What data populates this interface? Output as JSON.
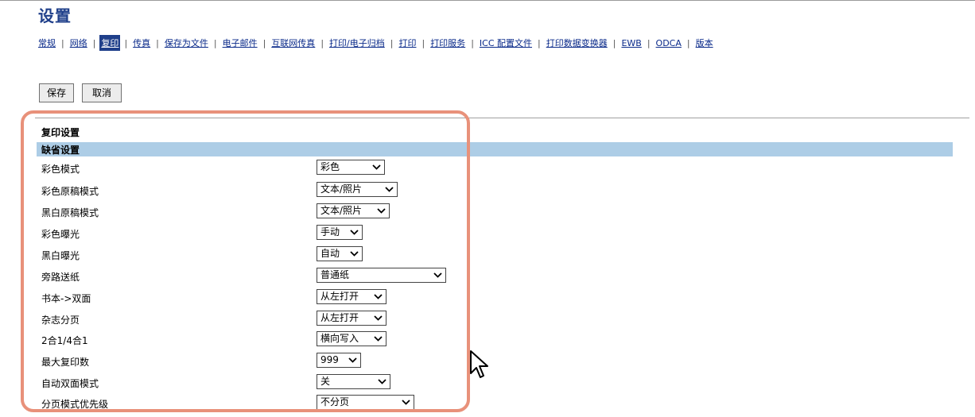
{
  "page": {
    "title": "设置"
  },
  "tabs": [
    {
      "label": "常规",
      "active": false
    },
    {
      "label": "网络",
      "active": false
    },
    {
      "label": "复印",
      "active": true
    },
    {
      "label": "传真",
      "active": false
    },
    {
      "label": "保存为文件",
      "active": false
    },
    {
      "label": "电子邮件",
      "active": false
    },
    {
      "label": "互联网传真",
      "active": false
    },
    {
      "label": "打印/电子归档",
      "active": false
    },
    {
      "label": "打印",
      "active": false
    },
    {
      "label": "打印服务",
      "active": false
    },
    {
      "label": "ICC 配置文件",
      "active": false
    },
    {
      "label": "打印数据变换器",
      "active": false
    },
    {
      "label": "EWB",
      "active": false
    },
    {
      "label": "ODCA",
      "active": false
    },
    {
      "label": "版本",
      "active": false
    }
  ],
  "toolbar": {
    "save_label": "保存",
    "cancel_label": "取消"
  },
  "section": {
    "title": "复印设置",
    "band_label": "缺省设置"
  },
  "settings": [
    {
      "label": "彩色模式",
      "value": "彩色"
    },
    {
      "label": "彩色原稿模式",
      "value": "文本/照片"
    },
    {
      "label": "黑白原稿模式",
      "value": "文本/照片"
    },
    {
      "label": "彩色曝光",
      "value": "手动"
    },
    {
      "label": "黑白曝光",
      "value": "自动"
    },
    {
      "label": "旁路送纸",
      "value": "普通纸"
    },
    {
      "label": "书本->双面",
      "value": "从左打开"
    },
    {
      "label": "杂志分页",
      "value": "从左打开"
    },
    {
      "label": "2合1/4合1",
      "value": "横向写入"
    },
    {
      "label": "最大复印数",
      "value": "999"
    },
    {
      "label": "自动双面模式",
      "value": "关"
    },
    {
      "label": "分页模式优先级",
      "value": "不分页"
    }
  ],
  "colors": {
    "title": "#1f3f8a",
    "link": "#0a2a8a",
    "active_tab_bg": "#1f3f8a",
    "band": "#adcde6",
    "highlight_border": "#e8917a"
  },
  "icons": {
    "dropdown": "chevron-down-icon",
    "pointer": "mouse-pointer-icon"
  }
}
